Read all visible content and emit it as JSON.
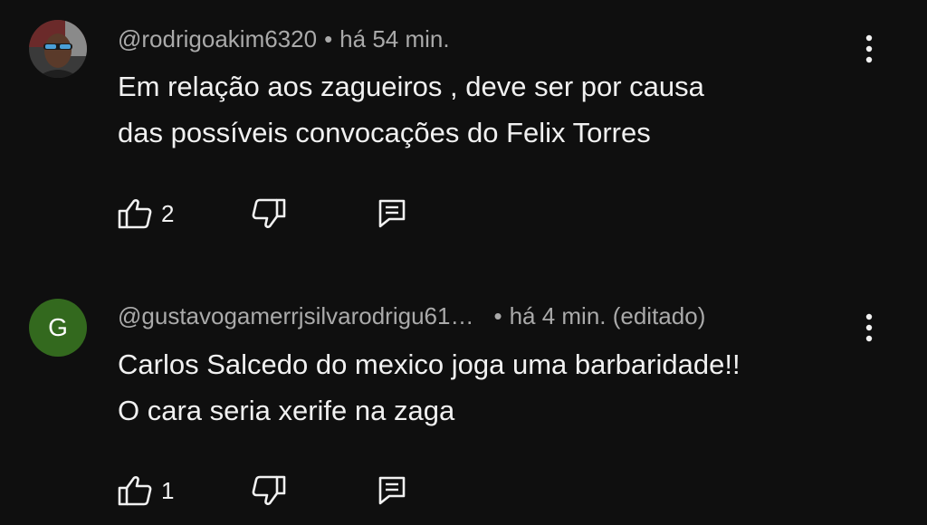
{
  "comments": [
    {
      "handle": "@rodrigoakim6320",
      "separator": "•",
      "time": "há 54 min.",
      "lines": [
        "Em relação aos zagueiros , deve ser por causa",
        "das possíveis convocações do Felix Torres"
      ],
      "like_count": "2",
      "avatar": {
        "type": "photo"
      },
      "icons": {
        "like": "thumbs-up-icon",
        "dislike": "thumbs-down-icon",
        "reply": "reply-icon",
        "more": "more-vertical-icon"
      }
    },
    {
      "handle": "@gustavogamerrjsilvarodrigu61…",
      "separator": "•",
      "time": "há 4 min. (editado)",
      "lines": [
        "Carlos Salcedo do mexico joga uma barbaridade!!",
        "O cara seria xerife na zaga"
      ],
      "like_count": "1",
      "avatar": {
        "type": "letter",
        "letter": "G",
        "color": "#33691e"
      },
      "icons": {
        "like": "thumbs-up-icon",
        "dislike": "thumbs-down-icon",
        "reply": "reply-icon",
        "more": "more-vertical-icon"
      }
    }
  ],
  "theme": {
    "background": "#0f0f0f",
    "text": "#f1f1f1",
    "meta_text": "#aaaaaa"
  }
}
